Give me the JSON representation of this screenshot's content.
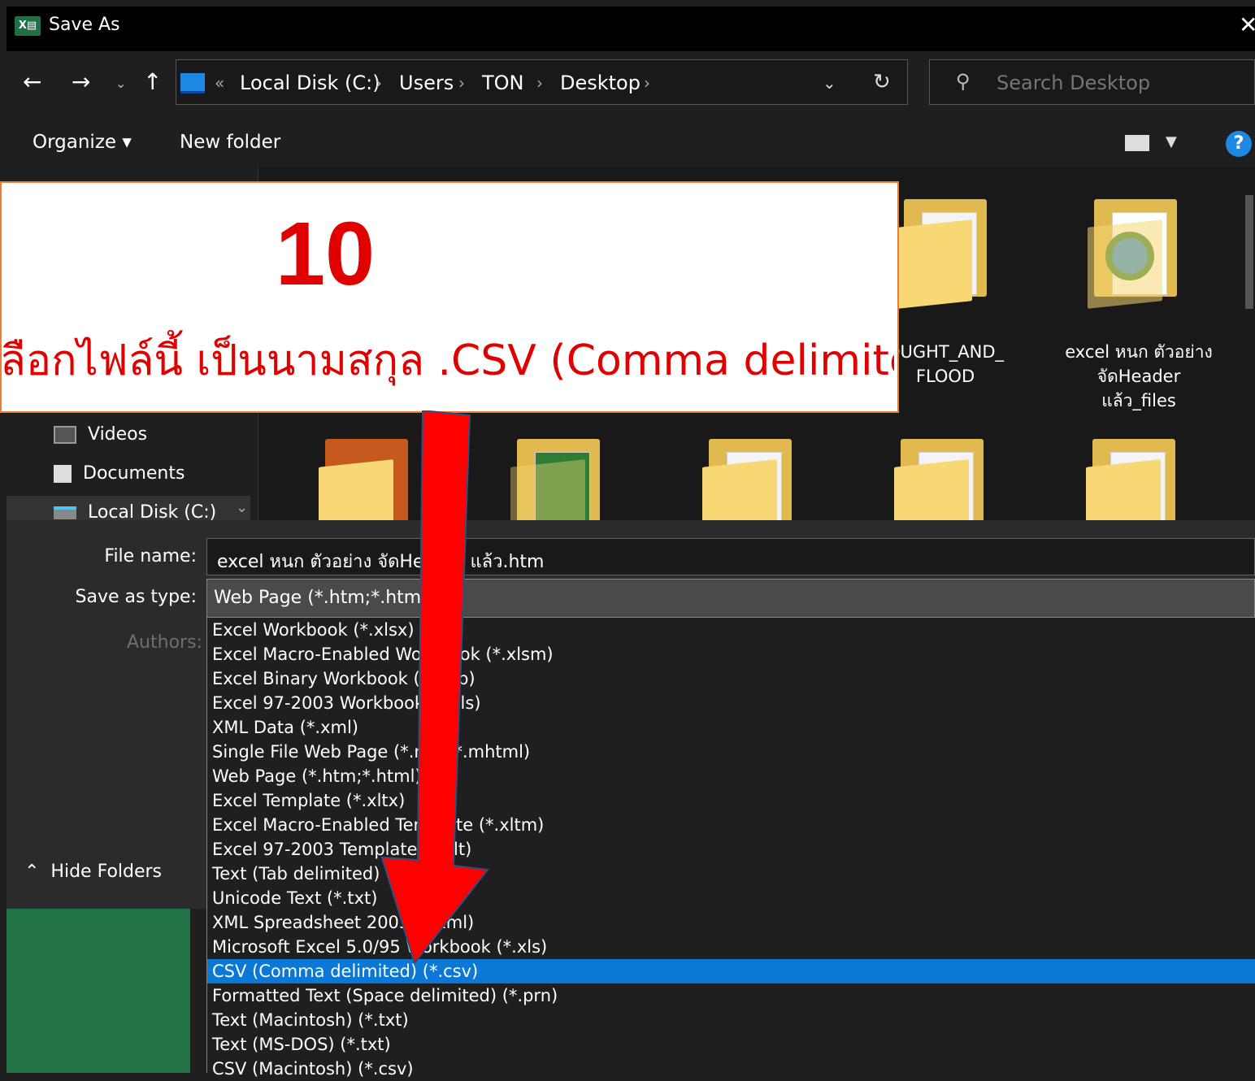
{
  "window": {
    "title": "Save As",
    "app_icon": "excel-icon"
  },
  "address": {
    "crumbs_prefix": "«",
    "crumbs": [
      "Local Disk (C:)",
      "Users",
      "TON",
      "Desktop"
    ],
    "separator": "›",
    "search_placeholder": "Search Desktop"
  },
  "toolbar": {
    "organize_label": "Organize ▾",
    "new_folder_label": "New folder",
    "help_label": "?"
  },
  "nav_pane": {
    "items": [
      "Videos",
      "Documents",
      "Local Disk (C:)"
    ]
  },
  "content": {
    "row1_labels": [
      "OUGHT_AND_\nFLOOD",
      "excel หนก ตัวอย่าง\nจัดHeader\nแล้ว_files"
    ]
  },
  "form": {
    "file_name_label": "File name:",
    "file_name_value": "excel หนก ตัวอย่าง จัดHeader แล้ว.htm",
    "save_type_label": "Save as type:",
    "save_type_value": "Web Page (*.htm;*.html)",
    "authors_label": "Authors:",
    "hide_folders_label": "Hide Folders"
  },
  "type_options": [
    "Excel Workbook (*.xlsx)",
    "Excel Macro-Enabled Workbook (*.xlsm)",
    "Excel Binary Workbook (*.xlsb)",
    "Excel 97-2003 Workbook (*.xls)",
    "XML Data (*.xml)",
    "Single File Web Page (*.mht;*.mhtml)",
    "Web Page (*.htm;*.html)",
    "Excel Template (*.xltx)",
    "Excel Macro-Enabled Template (*.xltm)",
    "Excel 97-2003 Template (*.xlt)",
    "Text (Tab delimited) (*.txt)",
    "Unicode Text (*.txt)",
    "XML Spreadsheet 2003 (*.xml)",
    "Microsoft Excel 5.0/95 Workbook (*.xls)",
    "CSV (Comma delimited) (*.csv)",
    "Formatted Text (Space delimited) (*.prn)",
    "Text (Macintosh) (*.txt)",
    "Text (MS-DOS) (*.txt)",
    "CSV (Macintosh) (*.csv)"
  ],
  "selected_type_index": 14,
  "callout": {
    "step": "10",
    "instruction": "ลือกไฟล์นี้ เป็นนามสกุล .CSV (Comma delimited)"
  },
  "colors": {
    "accent": "#0a78d4",
    "annotation_red": "#e00000",
    "callout_border": "#ed7d31",
    "excel_green": "#217346"
  }
}
